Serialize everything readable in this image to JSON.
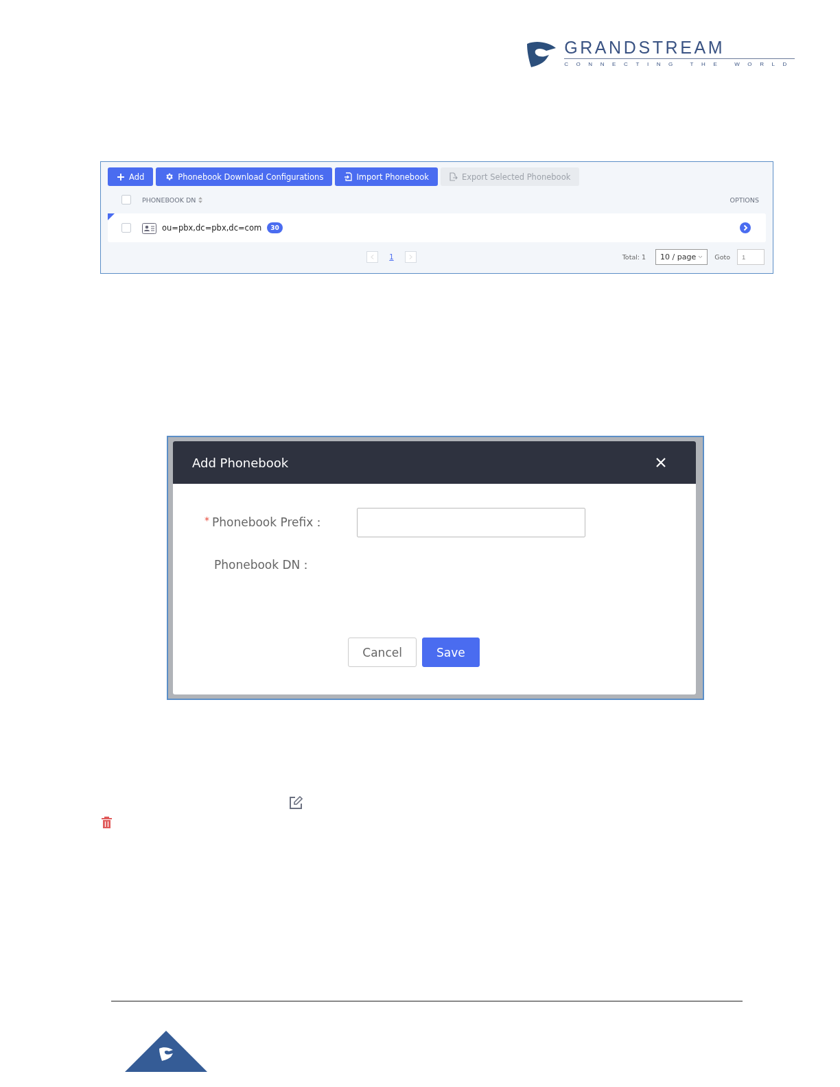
{
  "header": {
    "brand": "GRANDSTREAM",
    "tagline": "CONNECTING THE WORLD"
  },
  "phonebook_list": {
    "toolbar": [
      {
        "label": "Add",
        "disabled": false
      },
      {
        "label": "Phonebook Download Configurations",
        "disabled": false
      },
      {
        "label": "Import Phonebook",
        "disabled": false
      },
      {
        "label": "Export Selected Phonebook",
        "disabled": true
      }
    ],
    "header_checked": false,
    "columns": [
      "PHONEBOOK DN",
      "OPTIONS"
    ],
    "rows": [
      {
        "checked": false,
        "dn": "ou=pbx,dc=pbx,dc=com",
        "count": "30"
      }
    ],
    "pagination": {
      "pages": [
        {
          "label": "1",
          "selected": true
        }
      ],
      "total": "Total: 1",
      "page_size": "10 / page",
      "goto_label": "Goto",
      "goto_value": "1"
    }
  },
  "dialog": {
    "title": "Add Phonebook",
    "fields": [
      {
        "label": "Phonebook Prefix：",
        "required_mark": "*",
        "kind": "input"
      },
      {
        "label": "Phonebook DN：",
        "kind": "text"
      }
    ],
    "buttons": [
      {
        "label": "Cancel",
        "primary": false
      },
      {
        "label": "Save",
        "primary": true
      }
    ]
  }
}
